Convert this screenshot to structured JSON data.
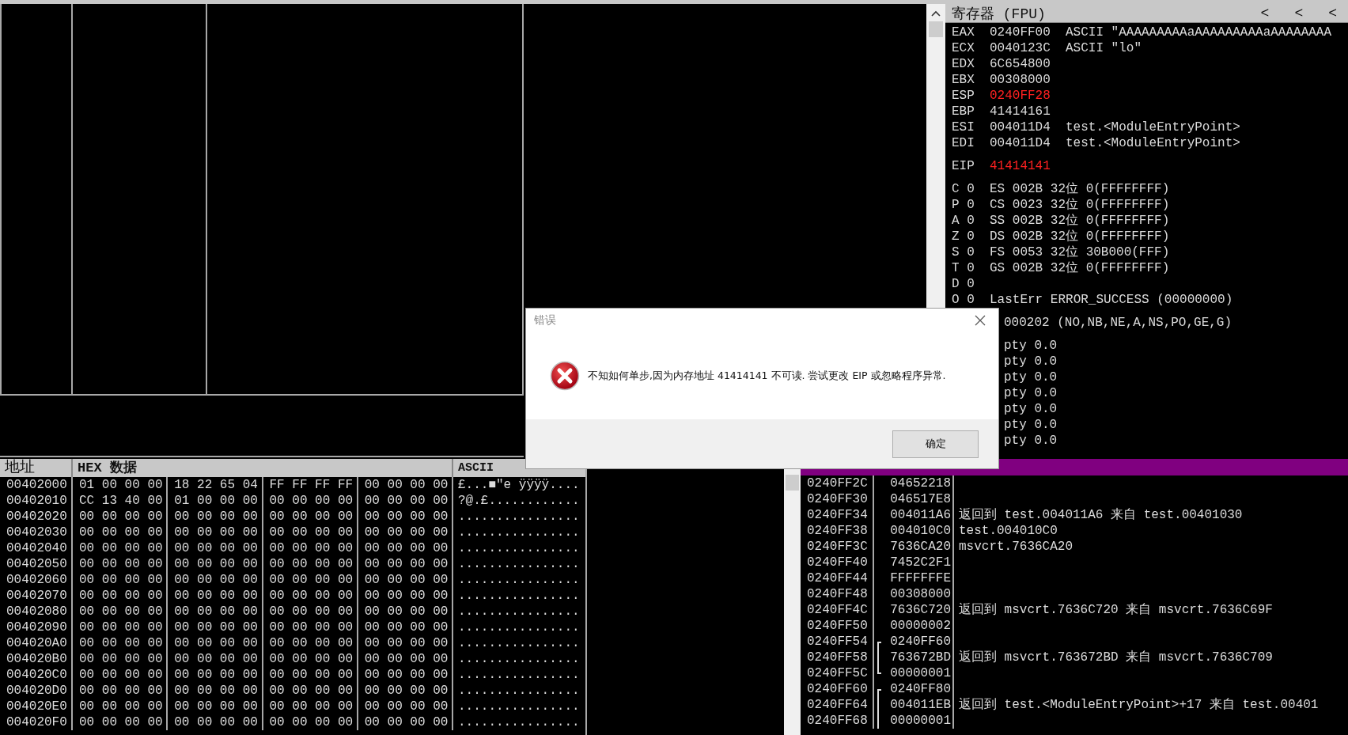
{
  "registers": {
    "title": "寄存器 (FPU)",
    "arrows": [
      "<",
      "<",
      "<"
    ],
    "groups": [
      [
        {
          "kind": "reg",
          "name": "EAX",
          "value": "0240FF00",
          "changed": false,
          "comment": "ASCII \"AAAAAAAAAaAAAAAAAAAaAAAAAAAA"
        },
        {
          "kind": "reg",
          "name": "ECX",
          "value": "0040123C",
          "changed": false,
          "comment": "ASCII \"lo\""
        },
        {
          "kind": "reg",
          "name": "EDX",
          "value": "6C654800",
          "changed": false
        },
        {
          "kind": "reg",
          "name": "EBX",
          "value": "00308000",
          "changed": false
        },
        {
          "kind": "reg",
          "name": "ESP",
          "value": "0240FF28",
          "changed": true
        },
        {
          "kind": "reg",
          "name": "EBP",
          "value": "41414161",
          "changed": false
        },
        {
          "kind": "reg",
          "name": "ESI",
          "value": "004011D4",
          "changed": false,
          "comment": "test.<ModuleEntryPoint>"
        },
        {
          "kind": "reg",
          "name": "EDI",
          "value": "004011D4",
          "changed": false,
          "comment": "test.<ModuleEntryPoint>"
        }
      ],
      [
        {
          "kind": "reg",
          "name": "EIP",
          "value": "41414141",
          "changed": true
        }
      ],
      [
        {
          "kind": "line",
          "text": "C 0  ES 002B 32位 0(FFFFFFFF)"
        },
        {
          "kind": "line",
          "text": "P 0  CS 0023 32位 0(FFFFFFFF)"
        },
        {
          "kind": "line",
          "text": "A 0  SS 002B 32位 0(FFFFFFFF)"
        },
        {
          "kind": "line",
          "text": "Z 0  DS 002B 32位 0(FFFFFFFF)"
        },
        {
          "kind": "line",
          "text": "S 0  FS 0053 32位 30B000(FFF)"
        },
        {
          "kind": "line",
          "text": "T 0  GS 002B 32位 0(FFFFFFFF)"
        },
        {
          "kind": "line",
          "text": "D 0"
        },
        {
          "kind": "line",
          "text": "O 0  LastErr ERROR_SUCCESS (00000000)"
        }
      ],
      [
        {
          "kind": "partial",
          "text": "000202 (NO,NB,NE,A,NS,PO,GE,G)"
        }
      ],
      [
        {
          "kind": "partial",
          "text": "pty 0.0"
        },
        {
          "kind": "partial",
          "text": "pty 0.0"
        },
        {
          "kind": "partial",
          "text": "pty 0.0"
        },
        {
          "kind": "partial",
          "text": "pty 0.0"
        },
        {
          "kind": "partial",
          "text": "pty 0.0"
        },
        {
          "kind": "partial",
          "text": "pty 0.0"
        },
        {
          "kind": "partial",
          "text": "pty 0.0"
        }
      ]
    ]
  },
  "dump": {
    "columns": [
      "地址",
      "HEX 数据",
      "ASCII"
    ],
    "rows": [
      {
        "address": "00402000",
        "hex": [
          "01 00 00 00",
          "18 22 65 04",
          "FF FF FF FF",
          "00 00 00 00"
        ],
        "ascii": "£...■\"e ÿÿÿÿ...."
      },
      {
        "address": "00402010",
        "hex": [
          "CC 13 40 00",
          "01 00 00 00",
          "00 00 00 00",
          "00 00 00 00"
        ],
        "ascii": "?@.£............"
      },
      {
        "address": "00402020",
        "hex": [
          "00 00 00 00",
          "00 00 00 00",
          "00 00 00 00",
          "00 00 00 00"
        ],
        "ascii": "................"
      },
      {
        "address": "00402030",
        "hex": [
          "00 00 00 00",
          "00 00 00 00",
          "00 00 00 00",
          "00 00 00 00"
        ],
        "ascii": "................"
      },
      {
        "address": "00402040",
        "hex": [
          "00 00 00 00",
          "00 00 00 00",
          "00 00 00 00",
          "00 00 00 00"
        ],
        "ascii": "................"
      },
      {
        "address": "00402050",
        "hex": [
          "00 00 00 00",
          "00 00 00 00",
          "00 00 00 00",
          "00 00 00 00"
        ],
        "ascii": "................"
      },
      {
        "address": "00402060",
        "hex": [
          "00 00 00 00",
          "00 00 00 00",
          "00 00 00 00",
          "00 00 00 00"
        ],
        "ascii": "................"
      },
      {
        "address": "00402070",
        "hex": [
          "00 00 00 00",
          "00 00 00 00",
          "00 00 00 00",
          "00 00 00 00"
        ],
        "ascii": "................"
      },
      {
        "address": "00402080",
        "hex": [
          "00 00 00 00",
          "00 00 00 00",
          "00 00 00 00",
          "00 00 00 00"
        ],
        "ascii": "................"
      },
      {
        "address": "00402090",
        "hex": [
          "00 00 00 00",
          "00 00 00 00",
          "00 00 00 00",
          "00 00 00 00"
        ],
        "ascii": "................"
      },
      {
        "address": "004020A0",
        "hex": [
          "00 00 00 00",
          "00 00 00 00",
          "00 00 00 00",
          "00 00 00 00"
        ],
        "ascii": "................"
      },
      {
        "address": "004020B0",
        "hex": [
          "00 00 00 00",
          "00 00 00 00",
          "00 00 00 00",
          "00 00 00 00"
        ],
        "ascii": "................"
      },
      {
        "address": "004020C0",
        "hex": [
          "00 00 00 00",
          "00 00 00 00",
          "00 00 00 00",
          "00 00 00 00"
        ],
        "ascii": "................"
      },
      {
        "address": "004020D0",
        "hex": [
          "00 00 00 00",
          "00 00 00 00",
          "00 00 00 00",
          "00 00 00 00"
        ],
        "ascii": "................"
      },
      {
        "address": "004020E0",
        "hex": [
          "00 00 00 00",
          "00 00 00 00",
          "00 00 00 00",
          "00 00 00 00"
        ],
        "ascii": "................"
      },
      {
        "address": "004020F0",
        "hex": [
          "00 00 00 00",
          "00 00 00 00",
          "00 00 00 00",
          "00 00 00 00"
        ],
        "ascii": "................"
      }
    ]
  },
  "stack": {
    "rows": [
      {
        "kind": "plain",
        "address": "0240FF2C",
        "value": "04652218"
      },
      {
        "kind": "plain",
        "address": "0240FF30",
        "value": "046517E8"
      },
      {
        "kind": "plain",
        "address": "0240FF34",
        "value": "004011A6",
        "comment": "返回到 test.004011A6 来自 test.00401030"
      },
      {
        "kind": "plain",
        "address": "0240FF38",
        "value": "004010C0",
        "comment": "test.004010C0"
      },
      {
        "kind": "plain",
        "address": "0240FF3C",
        "value": "7636CA20",
        "comment": "msvcrt.7636CA20"
      },
      {
        "kind": "plain",
        "address": "0240FF40",
        "value": "7452C2F1"
      },
      {
        "kind": "plain",
        "address": "0240FF44",
        "value": "FFFFFFFE"
      },
      {
        "kind": "plain",
        "address": "0240FF48",
        "value": "00308000"
      },
      {
        "kind": "plain",
        "address": "0240FF4C",
        "value": "7636C720",
        "comment": "返回到 msvcrt.7636C720 来自 msvcrt.7636C69F"
      },
      {
        "kind": "plain",
        "address": "0240FF50",
        "value": "00000002"
      },
      {
        "kind": "frame_start",
        "address": "0240FF54",
        "value": "0240FF60"
      },
      {
        "kind": "frame_mid",
        "address": "0240FF58",
        "value": "763672BD",
        "comment": "返回到 msvcrt.763672BD 来自 msvcrt.7636C709"
      },
      {
        "kind": "frame_end",
        "address": "0240FF5C",
        "value": "00000001"
      },
      {
        "kind": "frame_start",
        "address": "0240FF60",
        "value": "0240FF80"
      },
      {
        "kind": "frame_mid",
        "address": "0240FF64",
        "value": "004011EB",
        "comment": "返回到 test.<ModuleEntryPoint>+17 来自 test.00401"
      },
      {
        "kind": "frame_mid",
        "address": "0240FF68",
        "value": "00000001"
      }
    ]
  },
  "dialog": {
    "title": "错误",
    "message": "不知如何单步,因为内存地址 41414141 不可读. 尝试更改 EIP 或忽略程序异常.",
    "button": "确定"
  }
}
